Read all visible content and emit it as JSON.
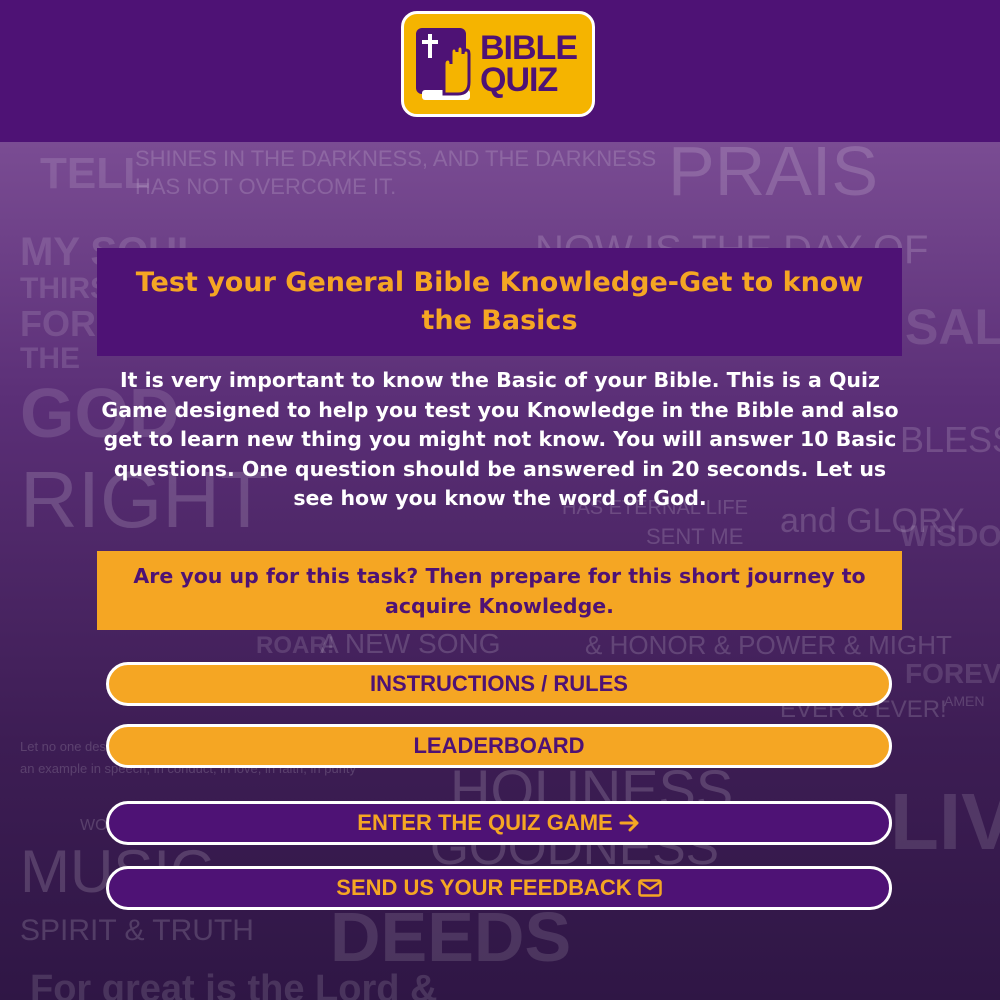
{
  "logo": {
    "word1": "BIBLE",
    "word2": "QUIZ",
    "icon": "bible-hand-icon"
  },
  "background_words": [
    "TELL",
    "SHINES IN THE DARKNESS, AND THE DARKNESS",
    "HAS NOT OVERCOME IT.",
    "PRAIS",
    "MY SOUL",
    "THIRST",
    "FOR",
    "THE",
    "NOW IS THE DAY OF",
    "SALVATION",
    "GOD",
    "RIGHT",
    "HAS ETERNAL LIFE",
    "SENT ME",
    "BLESSING",
    "and GLORY",
    "WISDOM",
    "A NEW SONG",
    "ROAR!",
    "& HONOR & POWER & MIGHT",
    "FOREVER",
    "EVER & EVER!",
    "AMEN",
    "Let no one despise you",
    "an example in speech, in conduct, in love, in faith, in purity",
    "MUSIC",
    "SPIRIT & TRUTH",
    "HOLINESS",
    "GOODNESS",
    "DEEDS",
    "LIVING",
    "For great is the Lord &",
    "WORSHIP Him"
  ],
  "main": {
    "title": "Test your General Bible Knowledge-Get to know the Basics",
    "description": "It is very important to know the Basic of your Bible. This is a Quiz Game designed to help you test you Knowledge in the Bible and also get to learn new thing you might not know. You will answer 10 Basic questions. One question should be answered in 20 seconds. Let us see how you know the word of God.",
    "cta": "Are you up for this task? Then prepare for this short journey to acquire Knowledge."
  },
  "buttons": {
    "instructions": "INSTRUCTIONS / RULES",
    "leaderboard": "LEADERBOARD",
    "enter": "ENTER THE QUIZ GAME",
    "enter_icon": "arrow-right-icon",
    "feedback": "SEND US YOUR FEEDBACK",
    "feedback_icon": "envelope-icon"
  },
  "colors": {
    "header_purple": "#4e1275",
    "accent_orange": "#f5a623",
    "logo_yellow": "#f5b400",
    "text_white": "#ffffff"
  }
}
